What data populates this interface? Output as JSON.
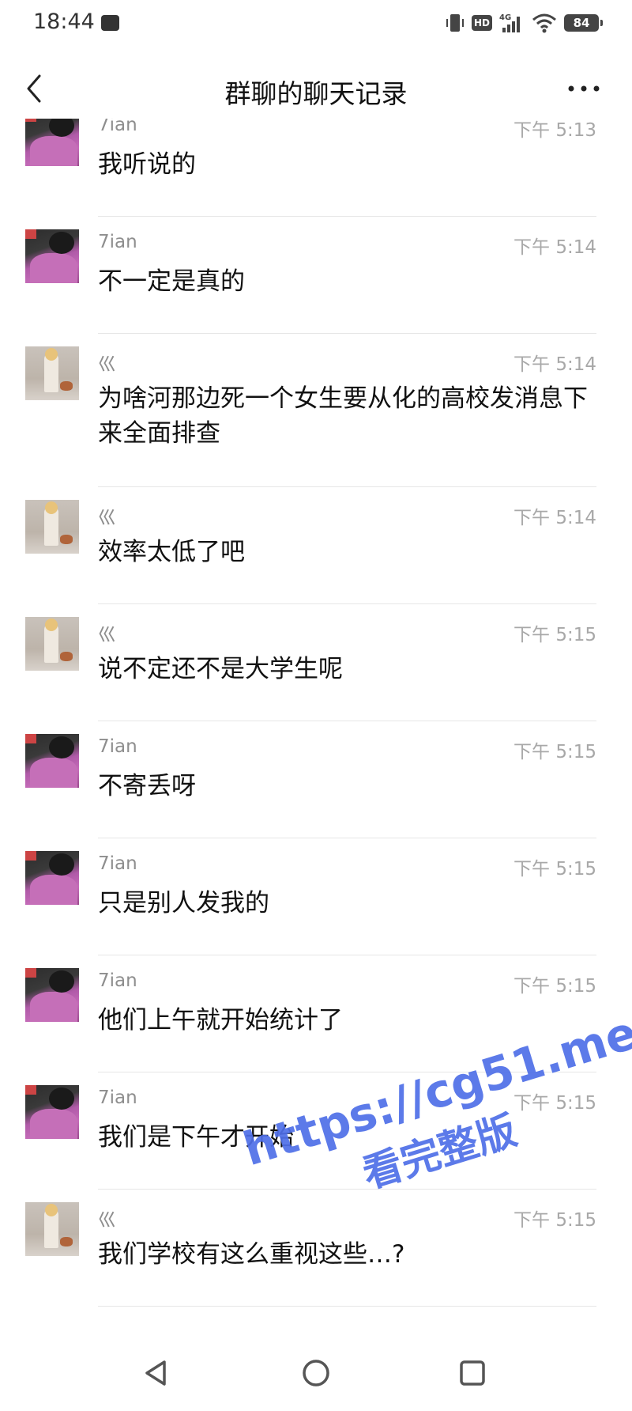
{
  "status_bar": {
    "time": "18:44",
    "network": "4G",
    "hd": "HD",
    "battery": "84"
  },
  "header": {
    "title": "群聊的聊天记录"
  },
  "messages": [
    {
      "sender": "7ian",
      "time": "下午 5:13",
      "text": "我听说的",
      "avatar": "pink-jacket-avatar"
    },
    {
      "sender": "7ian",
      "time": "下午 5:14",
      "text": "不一定是真的",
      "avatar": "pink-jacket-avatar"
    },
    {
      "sender": "巛",
      "time": "下午 5:14",
      "text": "为啥河那边死一个女生要从化的高校发消息下来全面排查",
      "avatar": "saint-painting-avatar"
    },
    {
      "sender": "巛",
      "time": "下午 5:14",
      "text": "效率太低了吧",
      "avatar": "saint-painting-avatar"
    },
    {
      "sender": "巛",
      "time": "下午 5:15",
      "text": "说不定还不是大学生呢",
      "avatar": "saint-painting-avatar"
    },
    {
      "sender": "7ian",
      "time": "下午 5:15",
      "text": "不寄丢呀",
      "avatar": "pink-jacket-avatar"
    },
    {
      "sender": "7ian",
      "time": "下午 5:15",
      "text": "只是别人发我的",
      "avatar": "pink-jacket-avatar"
    },
    {
      "sender": "7ian",
      "time": "下午 5:15",
      "text": "他们上午就开始统计了",
      "avatar": "pink-jacket-avatar"
    },
    {
      "sender": "7ian",
      "time": "下午 5:15",
      "text": "我们是下午才开始",
      "avatar": "pink-jacket-avatar"
    },
    {
      "sender": "巛",
      "time": "下午 5:15",
      "text": "我们学校有这么重视这些…?",
      "avatar": "saint-painting-avatar"
    }
  ],
  "watermark": {
    "url": "https://cg51.me",
    "subtitle": "看完整版"
  },
  "nav_bar": {
    "back": "triangle-back-icon",
    "home": "circle-home-icon",
    "recents": "square-recents-icon"
  }
}
